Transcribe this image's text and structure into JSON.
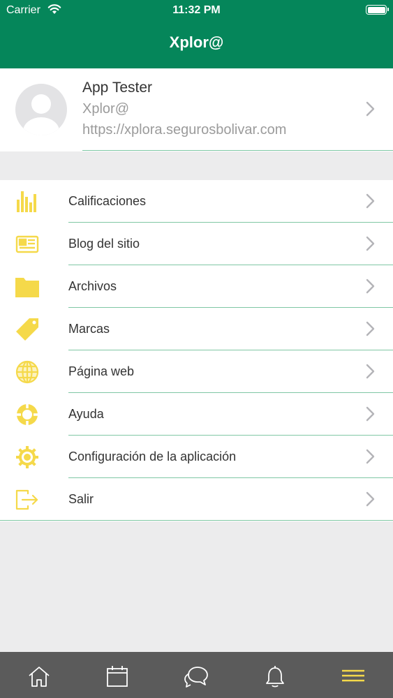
{
  "status_bar": {
    "carrier": "Carrier",
    "time": "11:32 PM"
  },
  "nav": {
    "title": "Xplor@"
  },
  "profile": {
    "name": "App Tester",
    "app": "Xplor@",
    "url": "https://xplora.segurosbolivar.com"
  },
  "menu": {
    "items": [
      {
        "label": "Calificaciones",
        "icon": "bar-chart-icon"
      },
      {
        "label": "Blog del sitio",
        "icon": "newspaper-icon"
      },
      {
        "label": "Archivos",
        "icon": "folder-icon"
      },
      {
        "label": "Marcas",
        "icon": "tag-icon"
      },
      {
        "label": "Página web",
        "icon": "globe-icon"
      },
      {
        "label": "Ayuda",
        "icon": "lifebuoy-icon"
      },
      {
        "label": "Configuración de la aplicación",
        "icon": "gear-icon"
      },
      {
        "label": "Salir",
        "icon": "logout-icon"
      }
    ]
  },
  "tabbar": {
    "tabs": [
      {
        "icon": "home-icon"
      },
      {
        "icon": "calendar-icon"
      },
      {
        "icon": "chat-icon"
      },
      {
        "icon": "bell-icon"
      },
      {
        "icon": "menu-icon",
        "active": true
      }
    ]
  },
  "colors": {
    "header": "#05865a",
    "accent_icon": "#f5d94a",
    "separator": "#7fc7a4",
    "tabbar": "#5b5b5b",
    "tab_active": "#f5d94a",
    "tab_inactive": "#ffffff"
  }
}
